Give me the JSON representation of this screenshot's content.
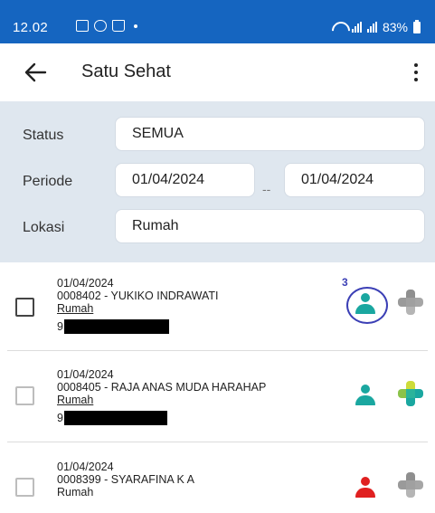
{
  "status_bar": {
    "time": "12.02",
    "battery": "83%"
  },
  "app_bar": {
    "title": "Satu Sehat"
  },
  "filters": {
    "status_label": "Status",
    "status_value": "SEMUA",
    "periode_label": "Periode",
    "periode_from": "01/04/2024",
    "periode_separator": "--",
    "periode_to": "01/04/2024",
    "lokasi_label": "Lokasi",
    "lokasi_value": "Rumah"
  },
  "annotation_number": "3",
  "records": [
    {
      "date": "01/04/2024",
      "patient": "0008402 - YUKIKO INDRAWATI",
      "location": "Rumah",
      "id_prefix": "9",
      "person_color": "#1aa7a0",
      "plus_icon": "grey",
      "checkbox": "enabled"
    },
    {
      "date": "01/04/2024",
      "patient": "0008405 - RAJA ANAS MUDA HARAHAP",
      "location": "Rumah",
      "id_prefix": "9",
      "person_color": "#1aa7a0",
      "plus_icon": "colored",
      "checkbox": "disabled"
    },
    {
      "date": "01/04/2024",
      "patient": "0008399 - SYARAFINA K A",
      "location": "Rumah",
      "person_color": "#e02020",
      "plus_icon": "grey",
      "checkbox": "disabled"
    }
  ],
  "colors": {
    "status_bar": "#1565c0",
    "filter_panel": "#dfe7ef",
    "teal": "#1aa7a0",
    "red": "#e02020",
    "grey_icon": "#9e9e9e",
    "annotation": "#3b3fb5"
  }
}
